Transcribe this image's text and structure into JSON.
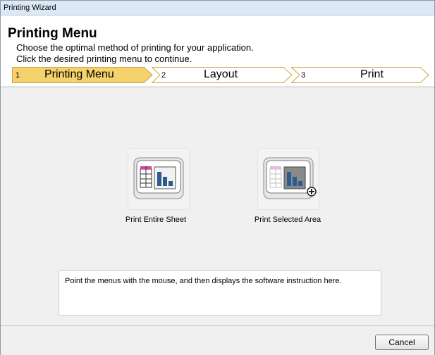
{
  "window": {
    "title": "Printing Wizard"
  },
  "header": {
    "title": "Printing Menu",
    "line1": "Choose the optimal method of printing for your application.",
    "line2": "Click the desired printing menu to continue."
  },
  "steps": [
    {
      "number": "1",
      "label": "Printing Menu",
      "active": true
    },
    {
      "number": "2",
      "label": "Layout",
      "active": false
    },
    {
      "number": "3",
      "label": "Print",
      "active": false
    }
  ],
  "menu": {
    "items": [
      {
        "label": "Print Entire Sheet",
        "icon": "entire-sheet-icon"
      },
      {
        "label": "Print Selected Area",
        "icon": "selected-area-icon"
      }
    ]
  },
  "instruction": "Point the menus with the mouse, and then displays the software instruction here.",
  "footer": {
    "cancel_label": "Cancel"
  },
  "colors": {
    "active_step": "#f6d26c",
    "inactive_step": "#ffffff",
    "step_border": "#c9a544"
  }
}
